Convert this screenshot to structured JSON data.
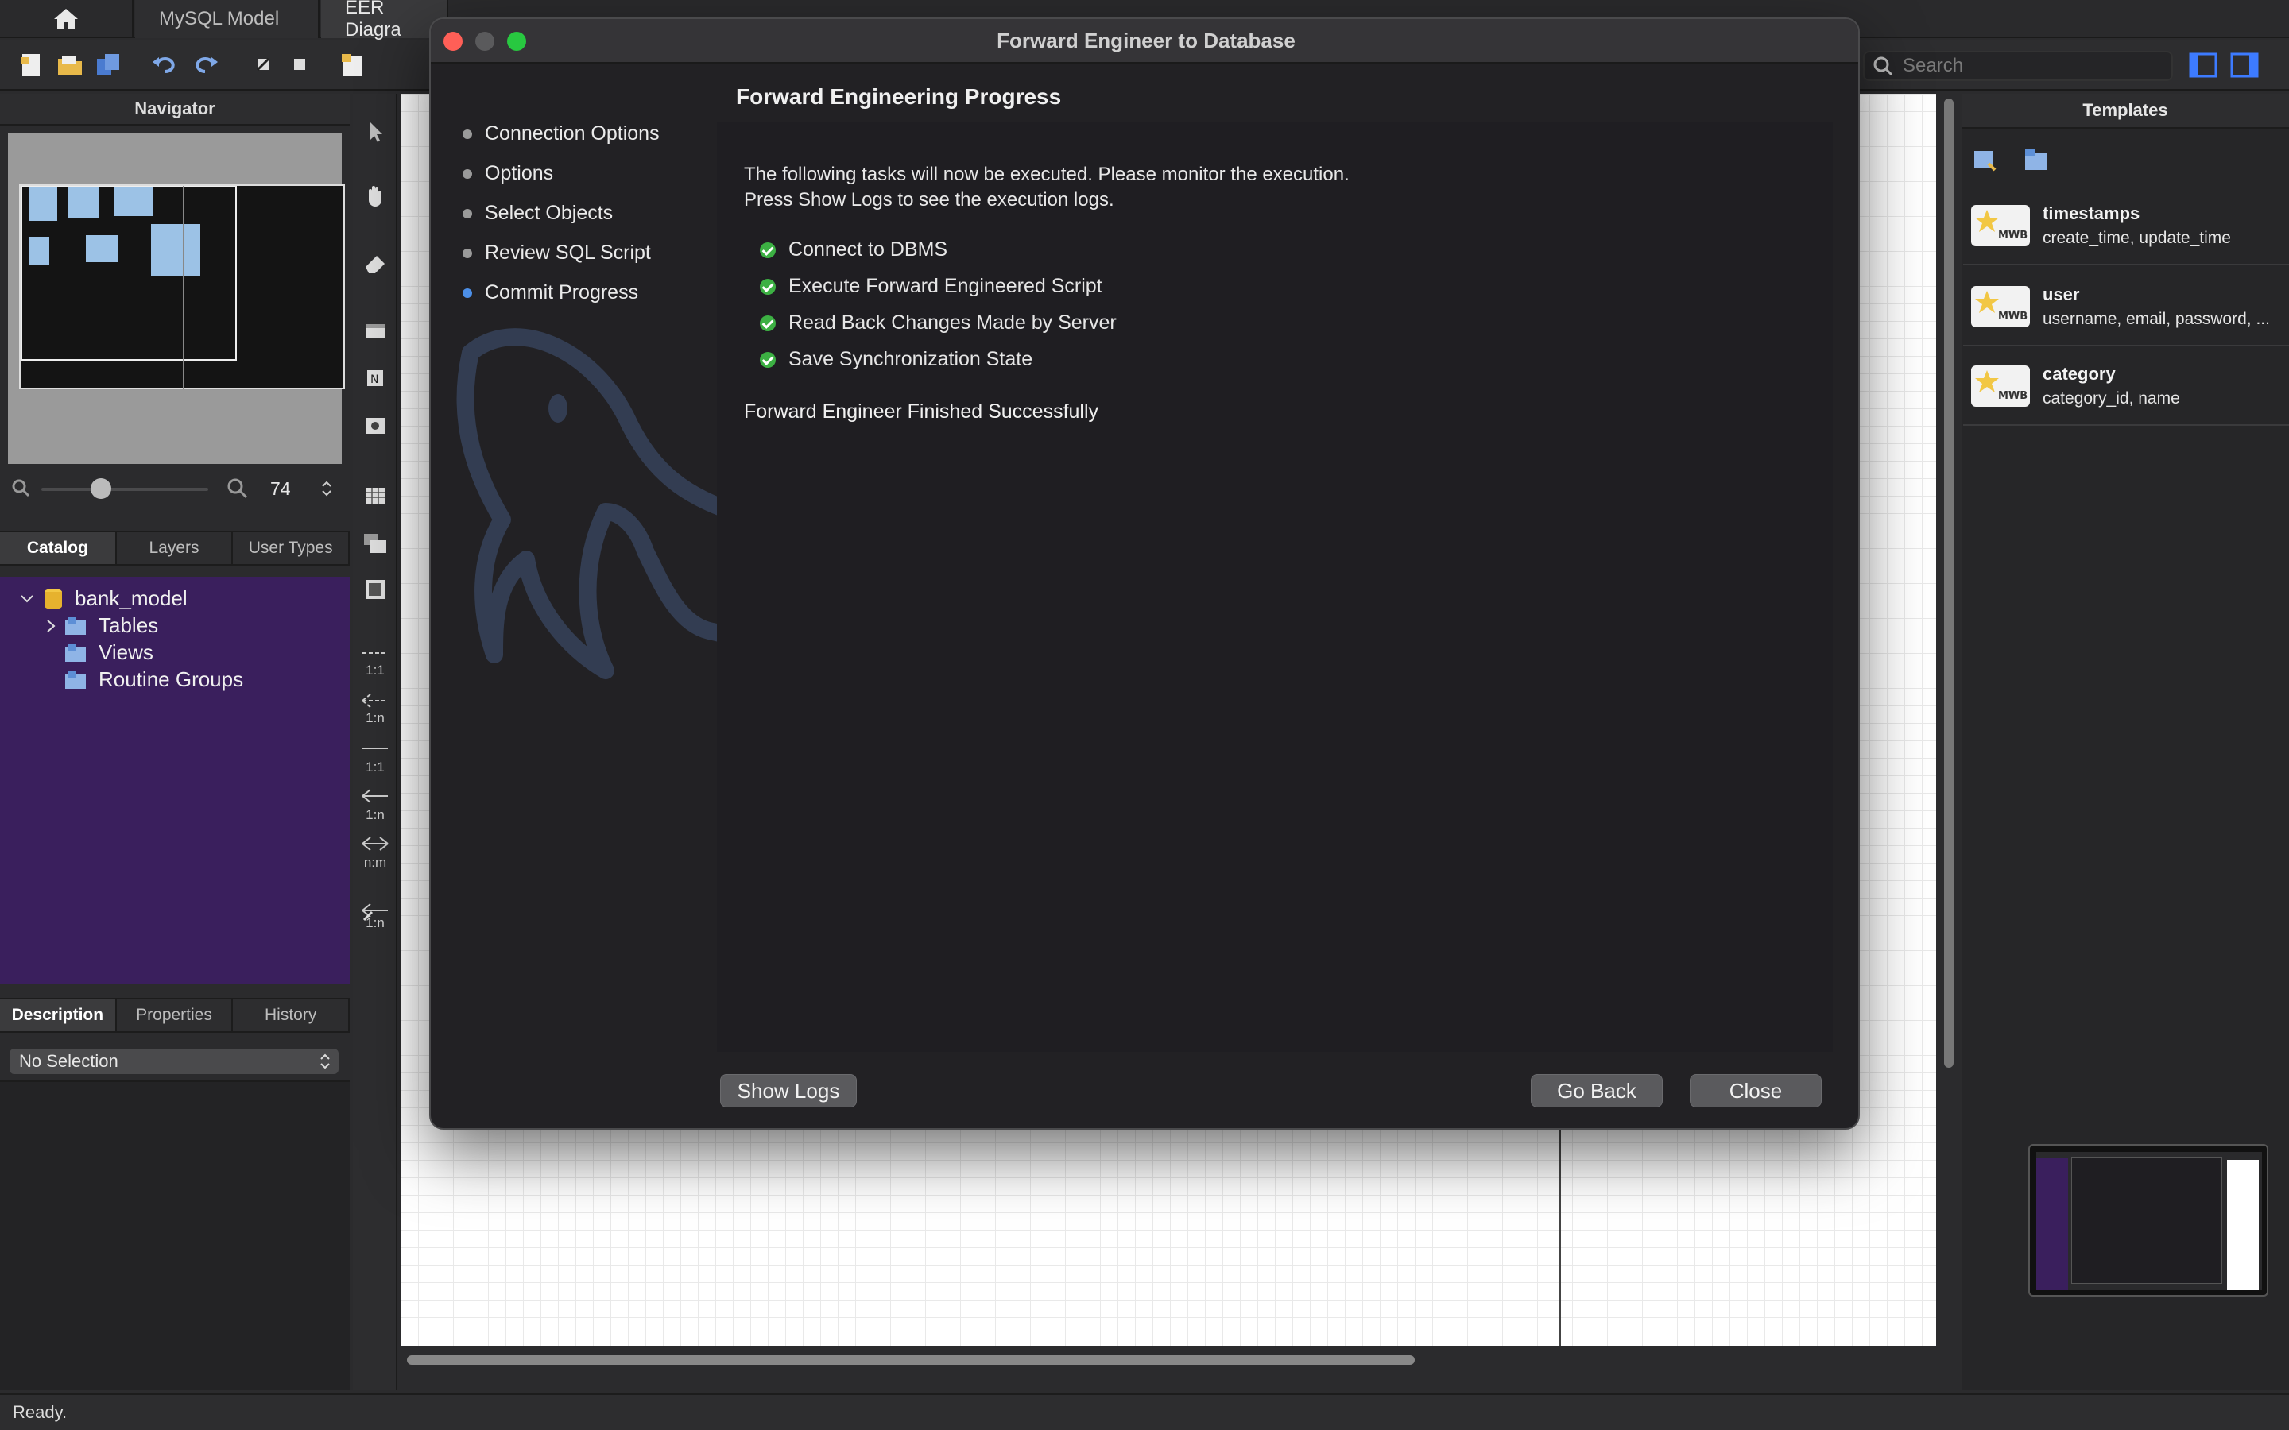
{
  "tabs": [
    {
      "label": "MySQL Model"
    },
    {
      "label": "EER Diagra"
    }
  ],
  "toolbar": {
    "search_placeholder": "Search"
  },
  "navigator": {
    "title": "Navigator",
    "zoom_value": "74"
  },
  "left_tabs": [
    "Catalog",
    "Layers",
    "User Types"
  ],
  "catalog": {
    "root": "bank_model",
    "children": [
      "Tables",
      "Views",
      "Routine Groups"
    ]
  },
  "info_tabs": [
    "Description",
    "Properties",
    "History"
  ],
  "description_select": "No Selection",
  "tool_labels": [
    "1:1",
    "1:n",
    "1:1",
    "1:n",
    "n:m",
    "1:n"
  ],
  "templates": {
    "title": "Templates",
    "items": [
      {
        "name": "timestamps",
        "desc": "create_time, update_time",
        "badge": "MWB"
      },
      {
        "name": "user",
        "desc": "username, email, password, ...",
        "badge": "MWB"
      },
      {
        "name": "category",
        "desc": "category_id, name",
        "badge": "MWB"
      }
    ]
  },
  "status": "Ready.",
  "dialog": {
    "title": "Forward Engineer to Database",
    "steps": [
      "Connection Options",
      "Options",
      "Select Objects",
      "Review SQL Script",
      "Commit Progress"
    ],
    "current_step": "Commit Progress",
    "heading": "Forward Engineering Progress",
    "intro_line1": "The following tasks will now be executed. Please monitor the execution.",
    "intro_line2": "Press Show Logs to see the execution logs.",
    "tasks": [
      "Connect to DBMS",
      "Execute Forward Engineered Script",
      "Read Back Changes Made by Server",
      "Save Synchronization State"
    ],
    "result": "Forward Engineer Finished Successfully",
    "buttons": {
      "show_logs": "Show Logs",
      "go_back": "Go Back",
      "close": "Close"
    }
  },
  "colors": {
    "catalog_bg": "#3a1f5d",
    "check_green": "#3cb043",
    "current_step_blue": "#4c8fe8",
    "traffic_red": "#ff5f57",
    "traffic_green": "#28c840"
  }
}
